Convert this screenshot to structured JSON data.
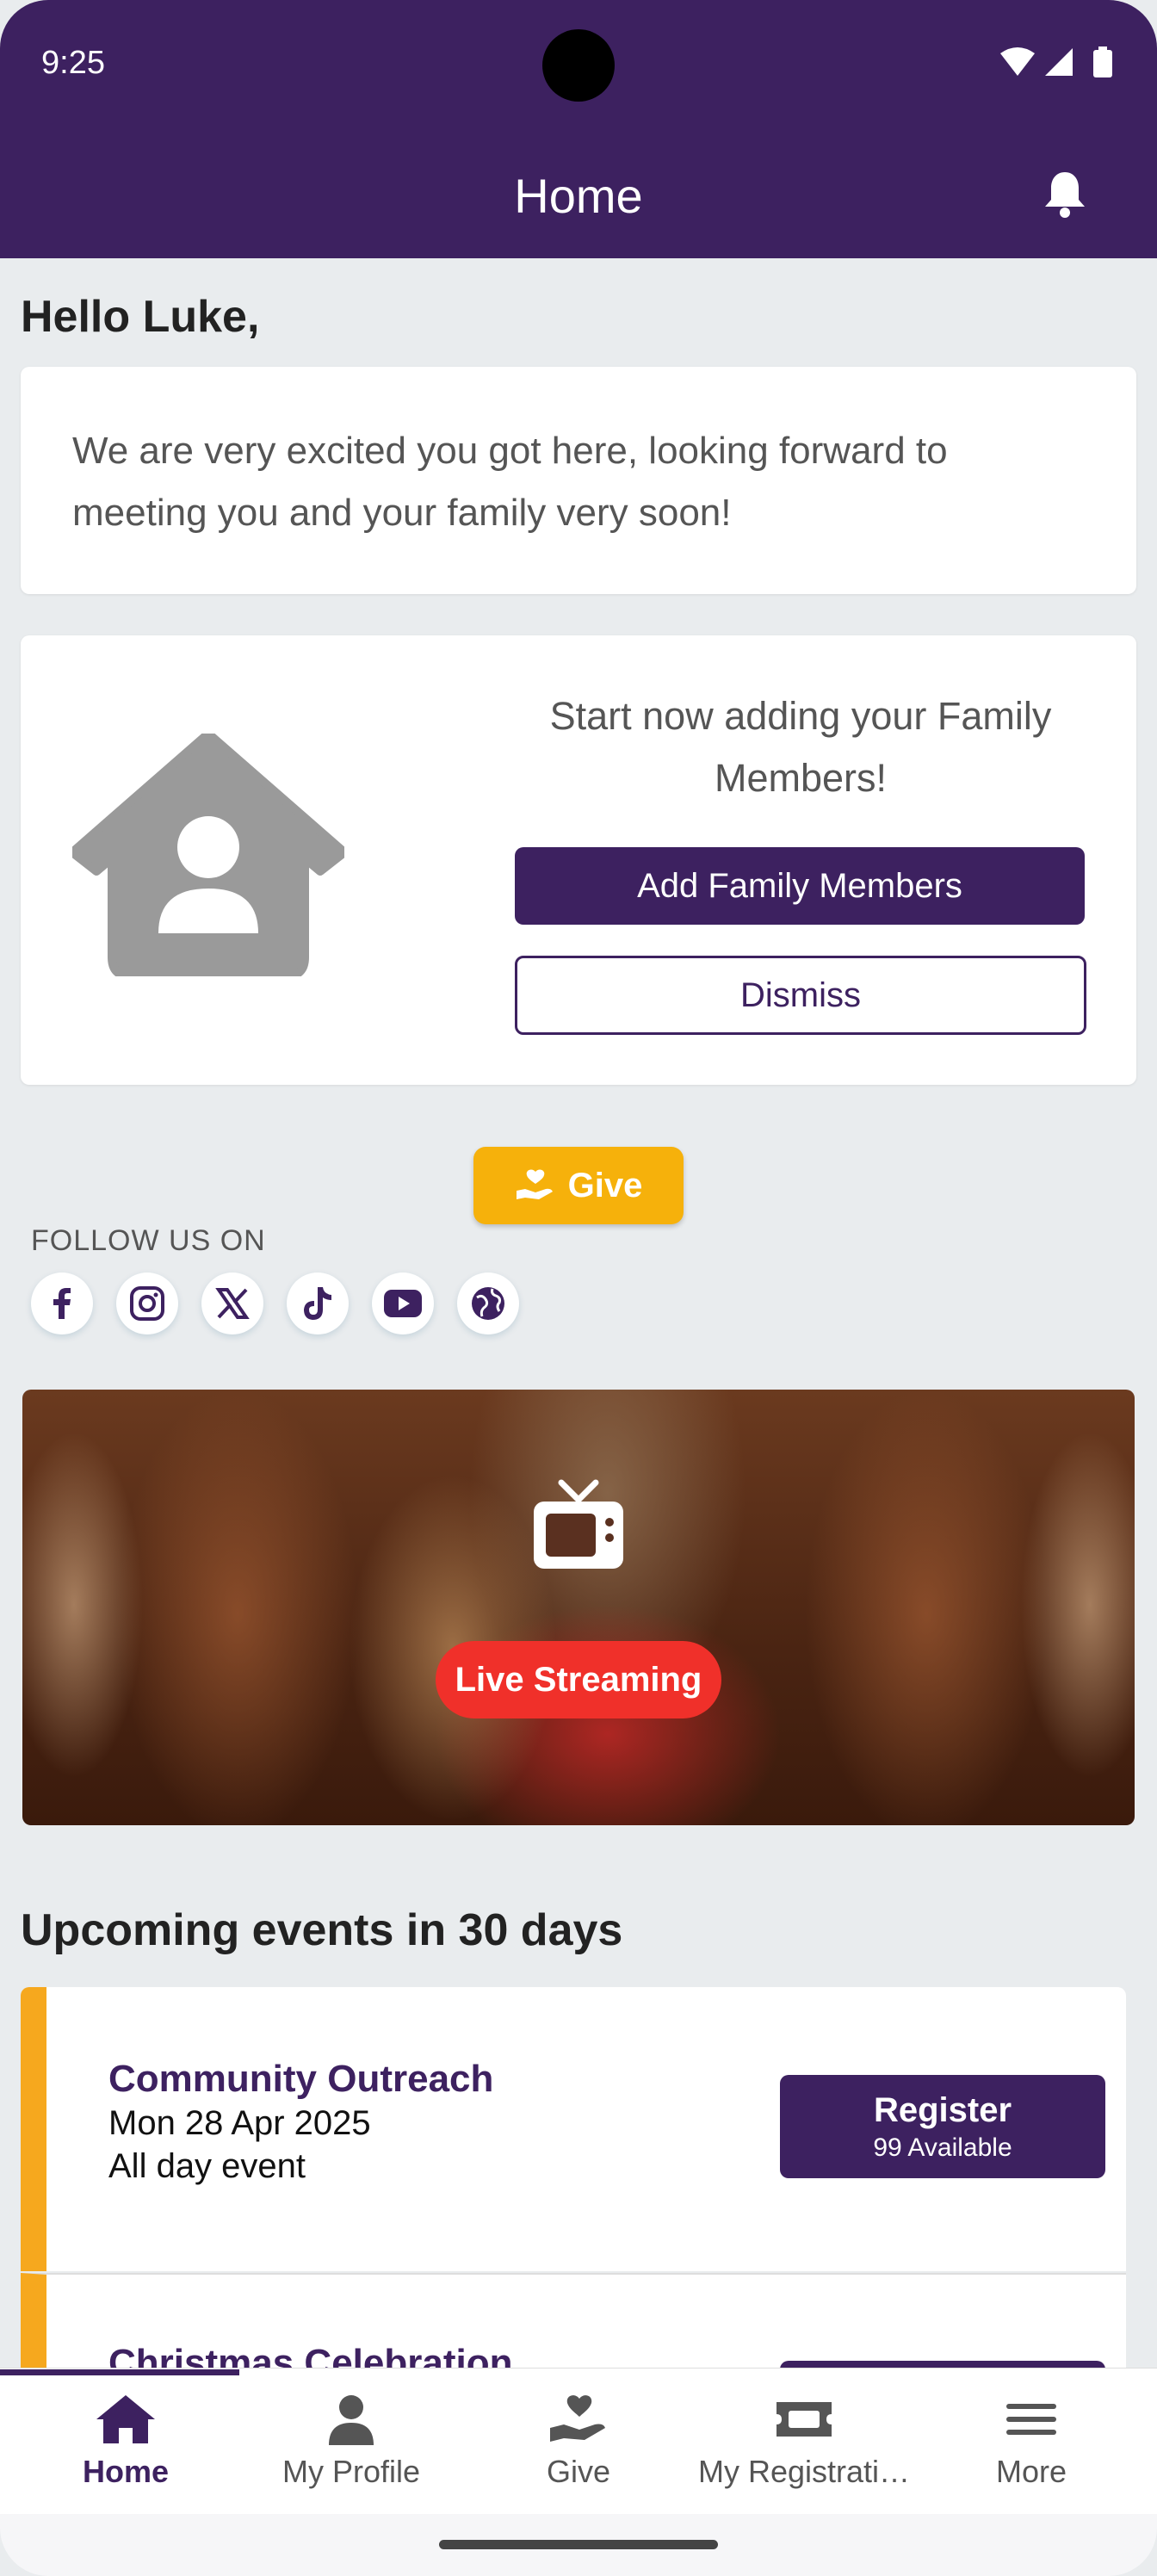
{
  "status_bar": {
    "time": "9:25"
  },
  "app_bar": {
    "title": "Home"
  },
  "greeting": "Hello Luke,",
  "welcome_message": "We are very excited you got here, looking forward to meeting you and your family very soon!",
  "family_card": {
    "prompt": "Start now adding your Family Members!",
    "add_button": "Add Family Members",
    "dismiss_button": "Dismiss"
  },
  "give_button": "Give",
  "follow": {
    "label": "FOLLOW US ON",
    "icons": [
      "facebook-icon",
      "instagram-icon",
      "x-icon",
      "tiktok-icon",
      "youtube-icon",
      "website-globe-icon"
    ]
  },
  "live": {
    "badge": "Live Streaming"
  },
  "events": {
    "heading": "Upcoming events in 30 days",
    "items": [
      {
        "title": "Community Outreach",
        "date": "Mon 28 Apr  2025",
        "time": "All day event",
        "register_label": "Register",
        "availability": "99 Available"
      },
      {
        "title": "Christmas Celebration"
      }
    ]
  },
  "bottom_nav": {
    "items": [
      {
        "label": "Home",
        "icon": "home-icon",
        "active": true
      },
      {
        "label": "My Profile",
        "icon": "person-icon"
      },
      {
        "label": "Give",
        "icon": "give-hand-icon"
      },
      {
        "label": "My Registrati…",
        "icon": "ticket-icon"
      },
      {
        "label": "More",
        "icon": "menu-icon"
      }
    ]
  },
  "colors": {
    "primary": "#3d2160",
    "accent": "#f6b10b",
    "live_red": "#f0302a",
    "event_bar": "#f6a81e"
  }
}
